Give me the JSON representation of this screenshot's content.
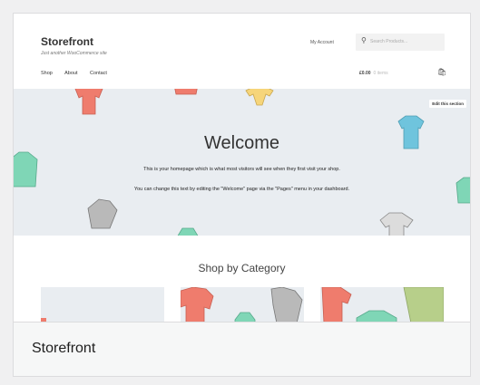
{
  "site": {
    "title": "Storefront",
    "tagline": "Just another WooCommerce site"
  },
  "header": {
    "my_account": "My Account",
    "search_placeholder": "Search Products...",
    "nav": [
      "Shop",
      "About",
      "Contact"
    ],
    "cart_price": "£0.00",
    "cart_items": "0 items"
  },
  "hero": {
    "edit_label": "Edit this section",
    "heading": "Welcome",
    "paragraph1": "This is your homepage which is what most visitors will see when they first visit your shop.",
    "paragraph2": "You can change this text by editing the \"Welcome\" page via the \"Pages\" menu in your dashboard."
  },
  "categories": {
    "heading": "Shop by Category"
  },
  "footer": {
    "theme_name": "Storefront"
  },
  "colors": {
    "hero_bg": "#e9edf1",
    "shirt_red": "#ef7c6d",
    "shirt_green": "#7fd6b6",
    "shirt_blue": "#6fc4dd",
    "shirt_yellow": "#f6d57a",
    "shirt_grey": "#b9b9b9"
  }
}
